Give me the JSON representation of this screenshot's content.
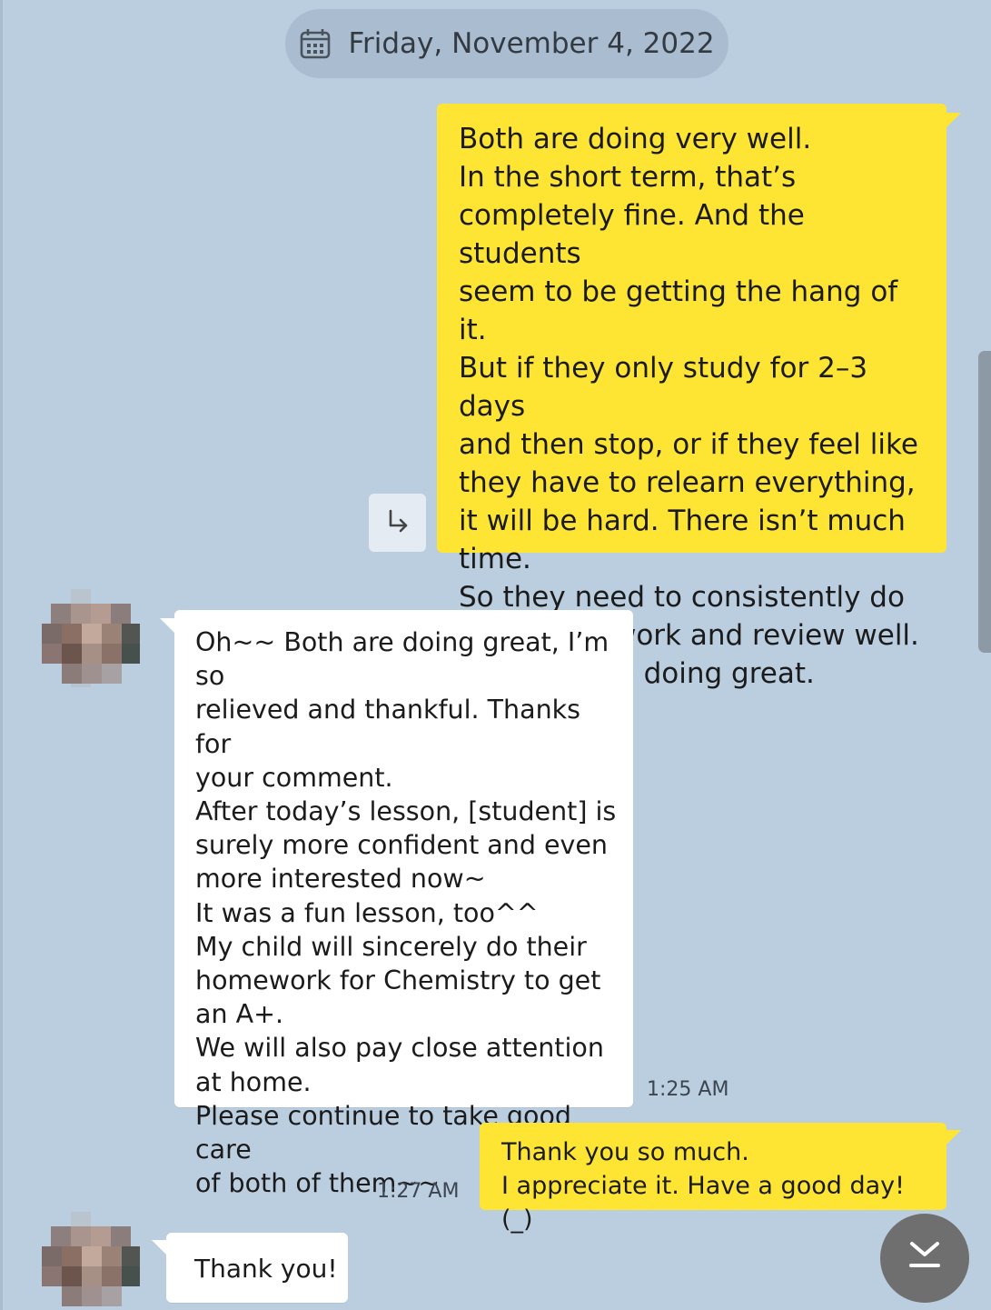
{
  "date_divider": {
    "icon": "calendar-icon",
    "text": "Friday, November 4, 2022"
  },
  "messages": [
    {
      "sender": "me",
      "text": "Both are doing very well.\nIn the short term, that’s\ncompletely fine. And the students\nseem to be getting the hang of it.\nBut if they only study for 2–3 days\nand then stop, or if they feel like\nthey have to relearn everything,\nit will be hard. There isn’t much time.\nSo they need to consistently do\ntheir homework and review well.\nYou both are doing great."
    },
    {
      "sender": "them",
      "text": "Oh~~ Both are doing great, I’m so\nrelieved and thankful. Thanks for\nyour comment.\nAfter today’s lesson, [student] is\nsurely more confident and even\nmore interested now~\nIt was a fun lesson, too^^\nMy child will sincerely do their\nhomework for Chemistry to get\nan A+.\nWe will also pay close attention\nat home.\nPlease continue to take good care\nof both of them~~",
      "time": "1:25 AM"
    },
    {
      "sender": "me",
      "text": "Thank you so much.\nI appreciate it. Have a good day! (_)",
      "time": "1:27 AM"
    },
    {
      "sender": "them",
      "text": "Thank you!"
    }
  ],
  "icons": {
    "reply": "reply-arrow-icon",
    "scroll_bottom": "scroll-to-bottom-icon"
  },
  "colors": {
    "background": "#bacee0",
    "my_bubble": "#fee533",
    "their_bubble": "#ffffff",
    "date_pill": "#aabdd0",
    "fab": "#6f6f6f"
  }
}
